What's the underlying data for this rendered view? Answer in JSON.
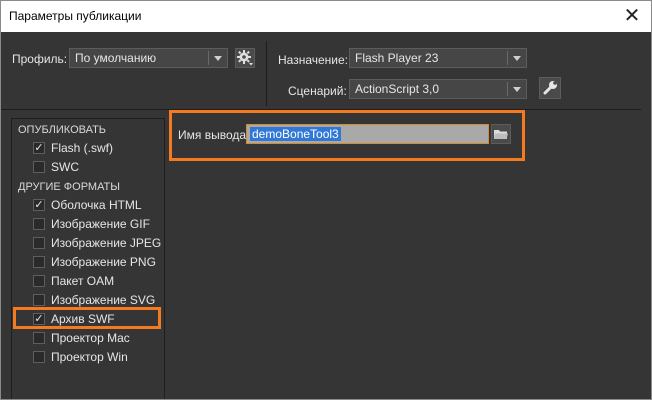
{
  "window": {
    "title": "Параметры публикации"
  },
  "header": {
    "profile_label": "Профиль:",
    "profile_value": "По умолчанию",
    "target_label": "Назначение:",
    "target_value": "Flash Player 23",
    "script_label": "Сценарий:",
    "script_value": "ActionScript 3,0"
  },
  "sidebar": {
    "publish_header": "ОПУБЛИКОВАТЬ",
    "other_header": "ДРУГИЕ ФОРМАТЫ",
    "publish_items": [
      {
        "label": "Flash (.swf)",
        "checked": true
      },
      {
        "label": "SWC",
        "checked": false
      }
    ],
    "other_items": [
      {
        "label": "Оболочка HTML",
        "checked": true
      },
      {
        "label": "Изображение GIF",
        "checked": false
      },
      {
        "label": "Изображение JPEG",
        "checked": false
      },
      {
        "label": "Изображение PNG",
        "checked": false
      },
      {
        "label": "Пакет OAM",
        "checked": false
      },
      {
        "label": "Изображение SVG",
        "checked": false
      },
      {
        "label": "Архив SWF",
        "checked": true
      },
      {
        "label": "Проектор Mac",
        "checked": false
      },
      {
        "label": "Проектор Win",
        "checked": false
      }
    ]
  },
  "output": {
    "label": "Имя вывода:",
    "value": "demoBoneTool3"
  },
  "colors": {
    "highlight": "#f47a20",
    "selection": "#2f78d6"
  }
}
